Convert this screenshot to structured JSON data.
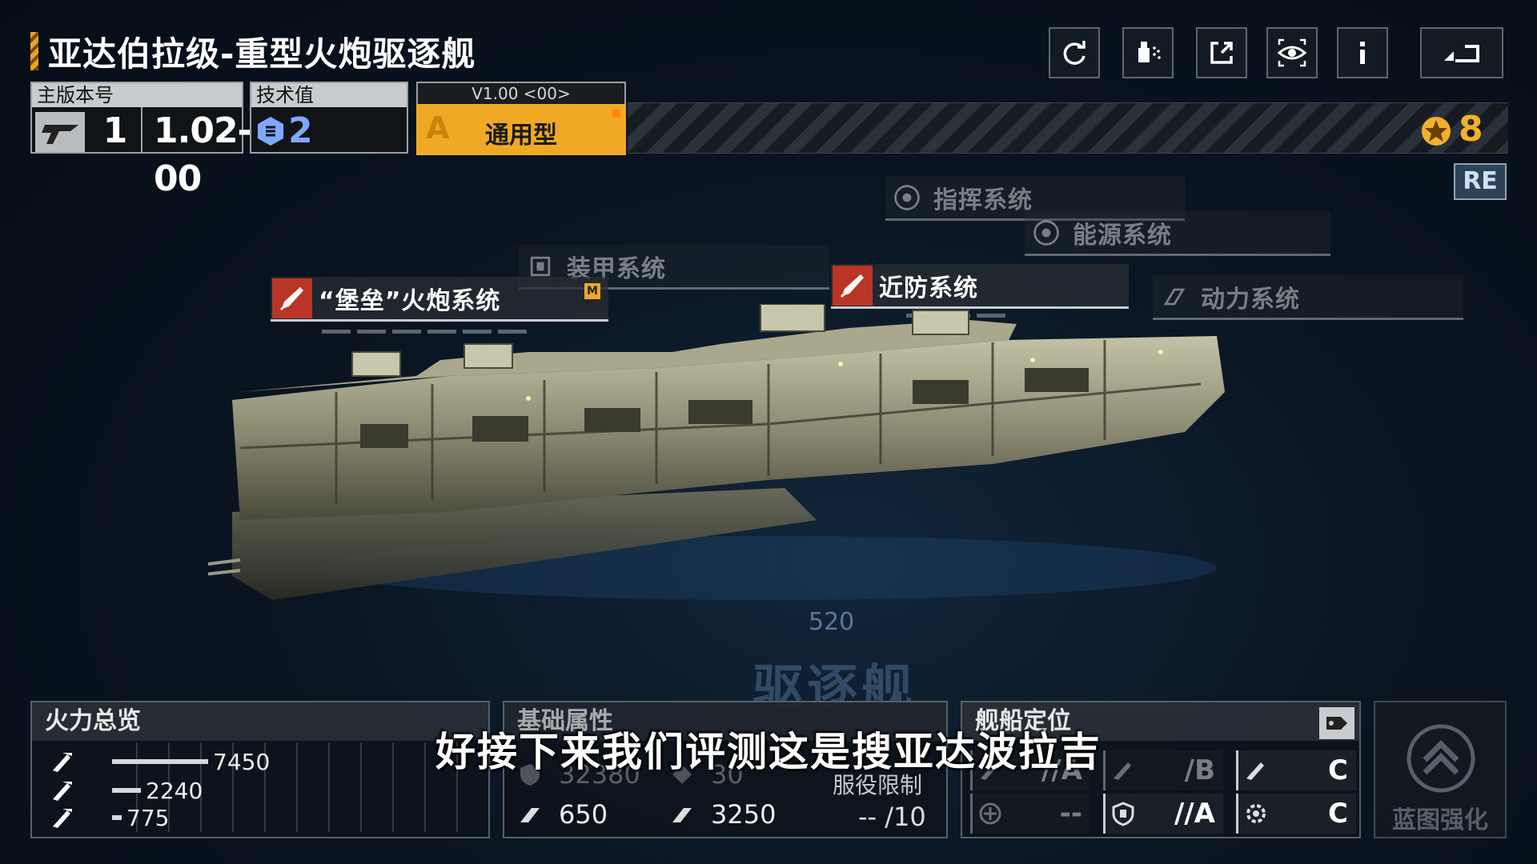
{
  "title": "亚达伯拉级-重型火炮驱逐舰",
  "toolbar": {
    "icons": [
      "refresh-icon",
      "paint-spray-icon",
      "external-link-icon",
      "eye-view-icon",
      "info-icon",
      "back-icon"
    ]
  },
  "version": {
    "label": "主版本号",
    "major": "1",
    "minor": "1.02-00"
  },
  "tech": {
    "label": "技术值",
    "value": "2"
  },
  "type_box": {
    "version": "V1.00 <00>",
    "grade": "A",
    "name": "通用型"
  },
  "rank": "8",
  "re_badge": "RE",
  "systems": {
    "command": "指挥系统",
    "energy": "能源系统",
    "armor": "装甲系统",
    "cannon": "“堡垒”火炮系统",
    "cannon_tag": "M",
    "point_defense": "近防系统",
    "propulsion": "动力系统"
  },
  "deck_number": "520",
  "class_watermark": "驱逐舰",
  "firepower": {
    "title": "火力总览",
    "rows": [
      {
        "value": "7450",
        "ratio": 1.0
      },
      {
        "value": "2240",
        "ratio": 0.3
      },
      {
        "value": "775",
        "ratio": 0.1
      }
    ]
  },
  "attributes": {
    "title": "基础属性",
    "top_left": "32380",
    "top_mid": "30",
    "service_label": "服役限制",
    "bottom_left": "650",
    "bottom_mid": "3250",
    "service_value": "--  /10"
  },
  "role": {
    "title": "舰船定位",
    "cells": [
      {
        "value": "//A"
      },
      {
        "value": "/B"
      },
      {
        "value": "C"
      },
      {
        "value": "--"
      },
      {
        "value": "//A"
      },
      {
        "value": "C"
      }
    ]
  },
  "blueprint": {
    "label": "蓝图强化"
  },
  "subtitle": "好接下来我们评测这是搜亚达波拉吉",
  "colors": {
    "accent_orange": "#f0a925",
    "hot_red": "#b93526",
    "tech_blue": "#7da9ff"
  }
}
